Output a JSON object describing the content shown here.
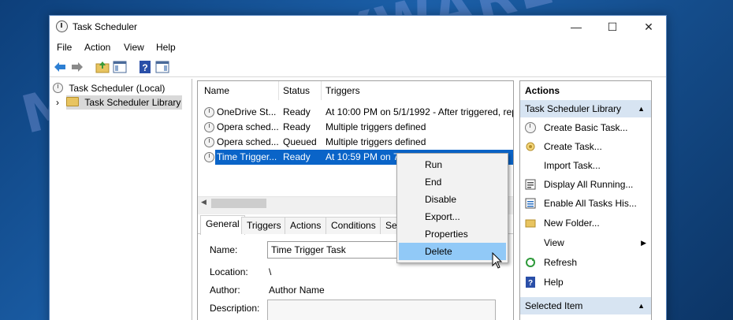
{
  "window": {
    "title": "Task Scheduler",
    "controls": {
      "minimize": "—",
      "maximize": "☐",
      "close": "✕"
    }
  },
  "menu": [
    "File",
    "Action",
    "View",
    "Help"
  ],
  "toolbar_icons": [
    "back-arrow-icon",
    "forward-arrow-icon",
    "up-folder-icon",
    "show-hide-console-tree-icon",
    "help-icon",
    "show-hide-action-pane-icon"
  ],
  "tree": {
    "root": "Task Scheduler (Local)",
    "child": "Task Scheduler Library",
    "expand_glyph": "›"
  },
  "task_list": {
    "columns": [
      "Name",
      "Status",
      "Triggers"
    ],
    "rows": [
      {
        "name": "OneDrive St...",
        "status": "Ready",
        "triggers": "At 10:00 PM on 5/1/1992 - After triggered, rep"
      },
      {
        "name": "Opera sched...",
        "status": "Ready",
        "triggers": "Multiple triggers defined"
      },
      {
        "name": "Opera sched...",
        "status": "Queued",
        "triggers": "Multiple triggers defined"
      },
      {
        "name": "Time Trigger...",
        "status": "Ready",
        "triggers": "At 10:59 PM on 7/1",
        "selected": true
      }
    ]
  },
  "details": {
    "tabs": [
      "General",
      "Triggers",
      "Actions",
      "Conditions",
      "Set"
    ],
    "active_tab": "General",
    "name_label": "Name:",
    "name_value": "Time Trigger Task",
    "location_label": "Location:",
    "location_value": "\\",
    "author_label": "Author:",
    "author_value": "Author Name",
    "description_label": "Description:"
  },
  "context_menu": {
    "items": [
      "Run",
      "End",
      "Disable",
      "Export...",
      "Properties",
      "Delete"
    ],
    "highlighted": "Delete"
  },
  "actions_pane": {
    "title": "Actions",
    "section1": "Task Scheduler Library",
    "items": [
      {
        "label": "Create Basic Task...",
        "icon": "create-basic-task-icon"
      },
      {
        "label": "Create Task...",
        "icon": "create-task-icon"
      },
      {
        "label": "Import Task...",
        "icon": ""
      },
      {
        "label": "Display All Running...",
        "icon": "display-running-icon"
      },
      {
        "label": "Enable All Tasks His...",
        "icon": "enable-history-icon"
      },
      {
        "label": "New Folder...",
        "icon": "new-folder-icon"
      },
      {
        "label": "View",
        "icon": ""
      },
      {
        "label": "Refresh",
        "icon": "refresh-icon"
      },
      {
        "label": "Help",
        "icon": "help-icon"
      }
    ],
    "section2": "Selected Item",
    "collapse_glyph": "▲",
    "submenu_glyph": "▶"
  },
  "watermark": "MYANTISPYWARE.COM",
  "colors": {
    "selection": "#0a64c8",
    "menu_hover": "#91c9f7",
    "section_header": "#d7e4f2",
    "background": "#1b5fa8"
  }
}
